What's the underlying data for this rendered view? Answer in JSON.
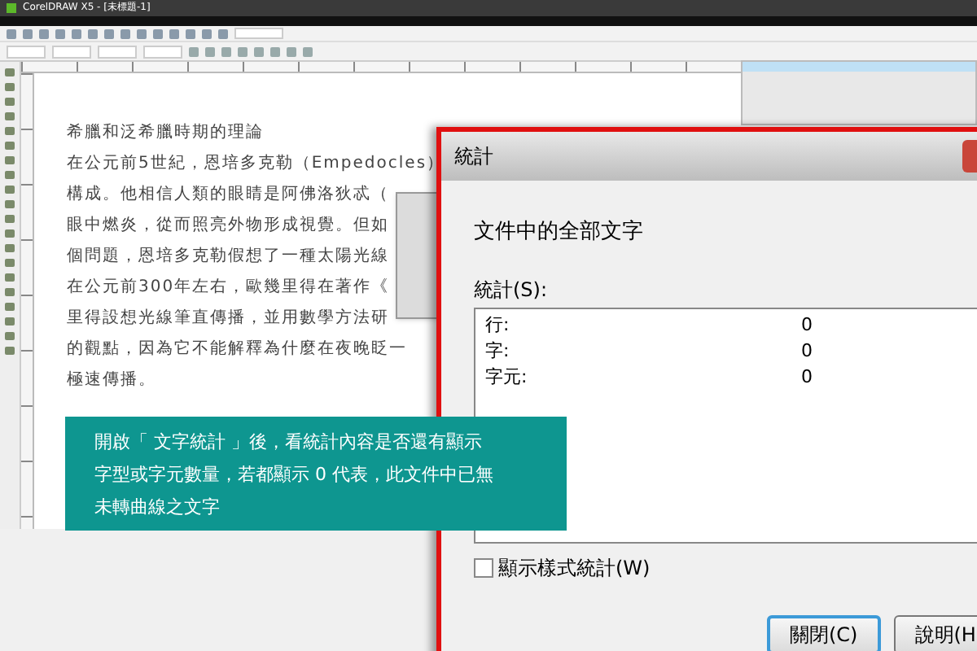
{
  "app": {
    "title": "CorelDRAW X5 - [未標題-1]"
  },
  "document": {
    "lines": [
      "希臘和泛希臘時期的理論",
      "在公元前5世紀，恩培多克勒（Empedocles）",
      "構成。他相信人類的眼睛是阿佛洛狄忒（",
      "眼中燃炎，從而照亮外物形成視覺。但如",
      "個問題，恩培多克勒假想了一種太陽光線",
      "在公元前300年左右，歐幾里得在著作《",
      "里得設想光線筆直傳播，並用數學方法研",
      "的觀點，因為它不能解釋為什麼在夜晚眨一",
      "極速傳播。"
    ]
  },
  "dialog": {
    "title": "統計",
    "heading": "文件中的全部文字",
    "list_label": "統計(S):",
    "stats": [
      {
        "label": "行:",
        "value": "0"
      },
      {
        "label": "字:",
        "value": "0"
      },
      {
        "label": "字元:",
        "value": "0"
      }
    ],
    "checkbox": {
      "label": "顯示樣式統計(W)",
      "checked": false
    },
    "buttons": [
      {
        "label": "關閉(C)",
        "default": true
      },
      {
        "label": "說明(H",
        "default": false
      }
    ]
  },
  "callout": {
    "lines": [
      "開啟「 文字統計 」後，看統計內容是否還有顯示",
      "字型或字元數量，若都顯示 0 代表，此文件中已無",
      "未轉曲線之文字"
    ]
  }
}
